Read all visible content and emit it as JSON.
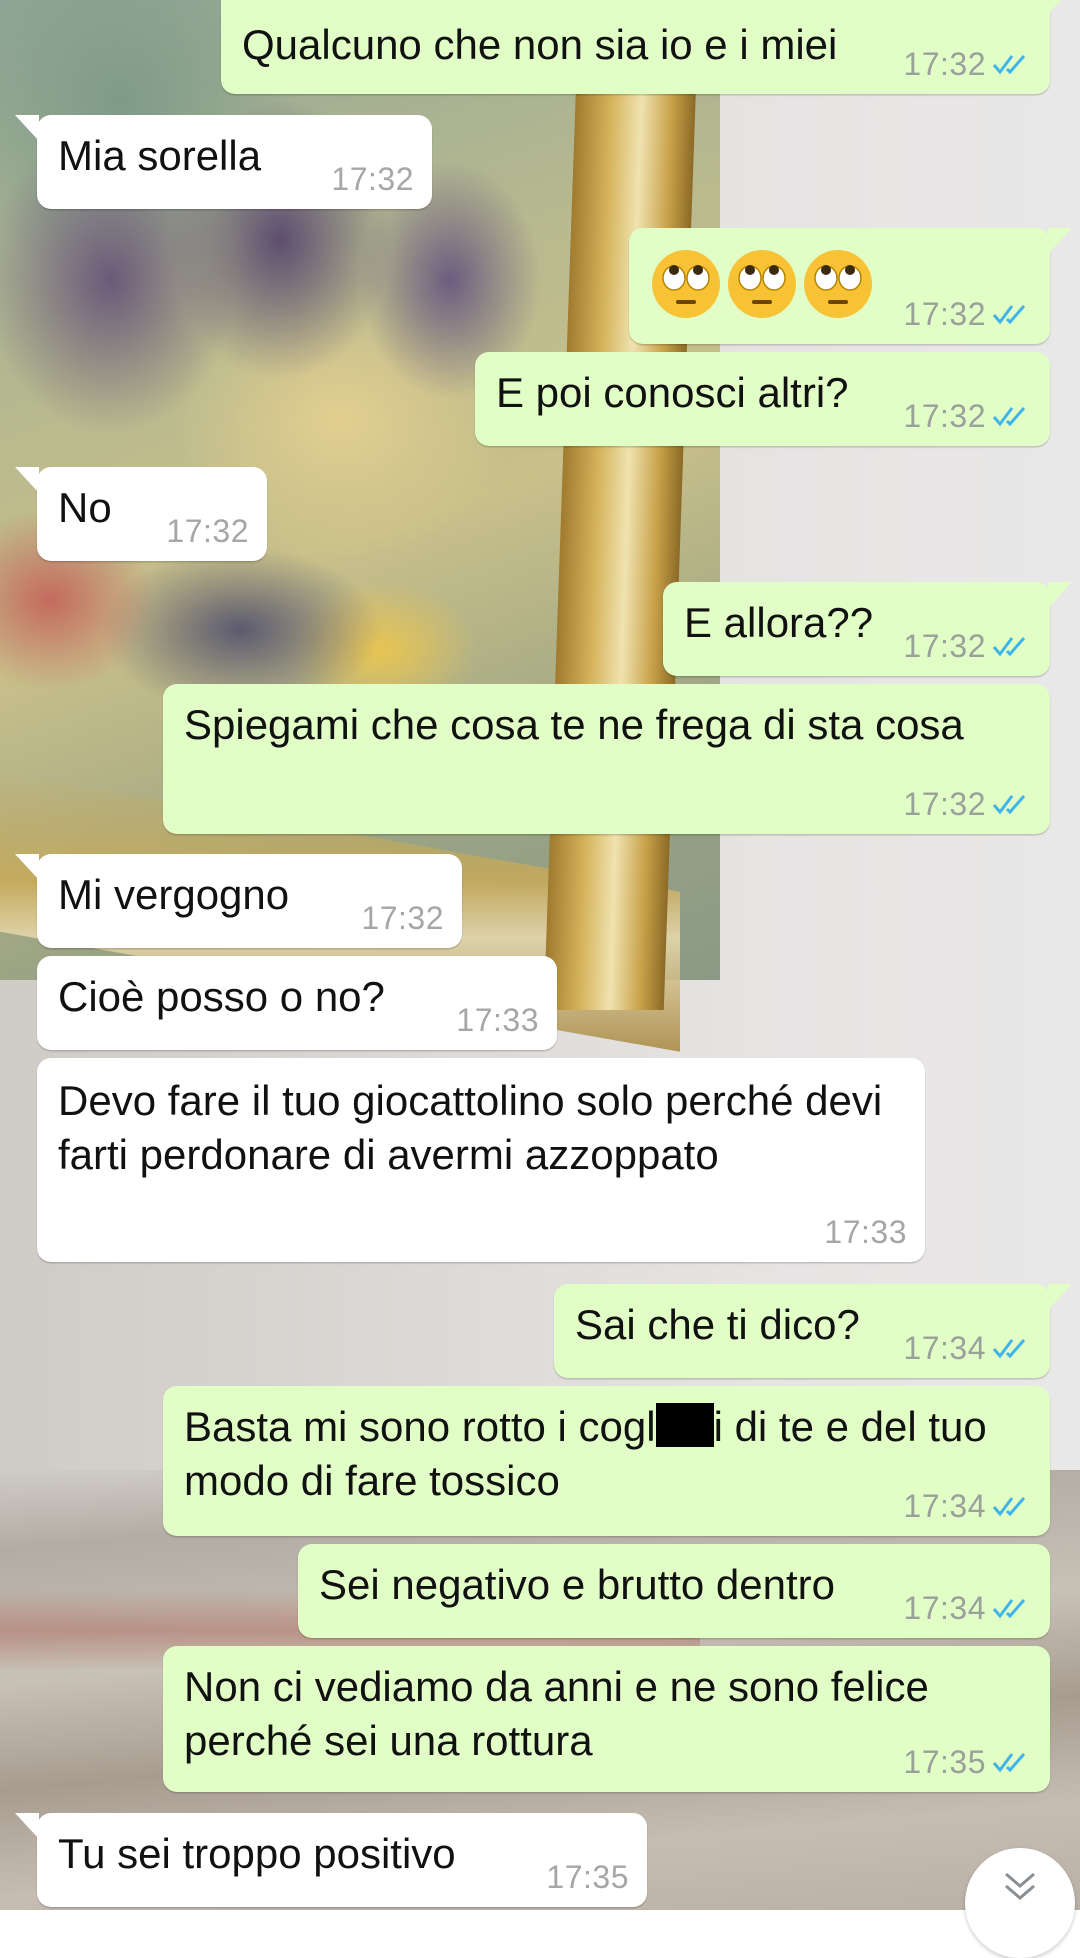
{
  "messages": [
    {
      "direction": "out",
      "text": "Qualcuno che non sia io e i miei",
      "time": "17:32",
      "status": "read"
    },
    {
      "direction": "in",
      "text": "Mia sorella",
      "time": "17:32"
    },
    {
      "direction": "out",
      "emoji": [
        "face-with-rolling-eyes",
        "face-with-rolling-eyes",
        "face-with-rolling-eyes"
      ],
      "time": "17:32",
      "status": "read"
    },
    {
      "direction": "out",
      "text": "E poi conosci altri?",
      "time": "17:32",
      "status": "read"
    },
    {
      "direction": "in",
      "text": "No",
      "time": "17:32"
    },
    {
      "direction": "out",
      "text": "E allora??",
      "time": "17:32",
      "status": "read"
    },
    {
      "direction": "out",
      "text": "Spiegami che cosa te ne frega di sta cosa",
      "time": "17:32",
      "status": "read"
    },
    {
      "direction": "in",
      "text": "Mi vergogno",
      "time": "17:32"
    },
    {
      "direction": "in",
      "text": "Cioè posso o no?",
      "time": "17:33"
    },
    {
      "direction": "in",
      "text": "Devo fare il tuo giocattolino solo perché devi farti perdonare di avermi azzoppato",
      "time": "17:33"
    },
    {
      "direction": "out",
      "text": "Sai che ti dico?",
      "time": "17:34",
      "status": "read"
    },
    {
      "direction": "out",
      "text_before_redaction": "Basta mi sono rotto i cogl",
      "text_after_redaction": "i di te e del tuo modo di fare tossico",
      "time": "17:34",
      "status": "read"
    },
    {
      "direction": "out",
      "text": "Sei negativo e brutto dentro",
      "time": "17:34",
      "status": "read"
    },
    {
      "direction": "out",
      "text": "Non ci vediamo da anni e ne sono felice perché sei una rottura",
      "time": "17:35",
      "status": "read"
    },
    {
      "direction": "in",
      "text": "Tu sei troppo positivo",
      "time": "17:35"
    }
  ],
  "colors": {
    "outgoing_bubble": "#e1fec6",
    "incoming_bubble": "#ffffff",
    "read_ticks": "#3fb4e8"
  },
  "icons": {
    "read_status": "double-check-icon",
    "scroll_down": "chevron-double-down-icon"
  }
}
